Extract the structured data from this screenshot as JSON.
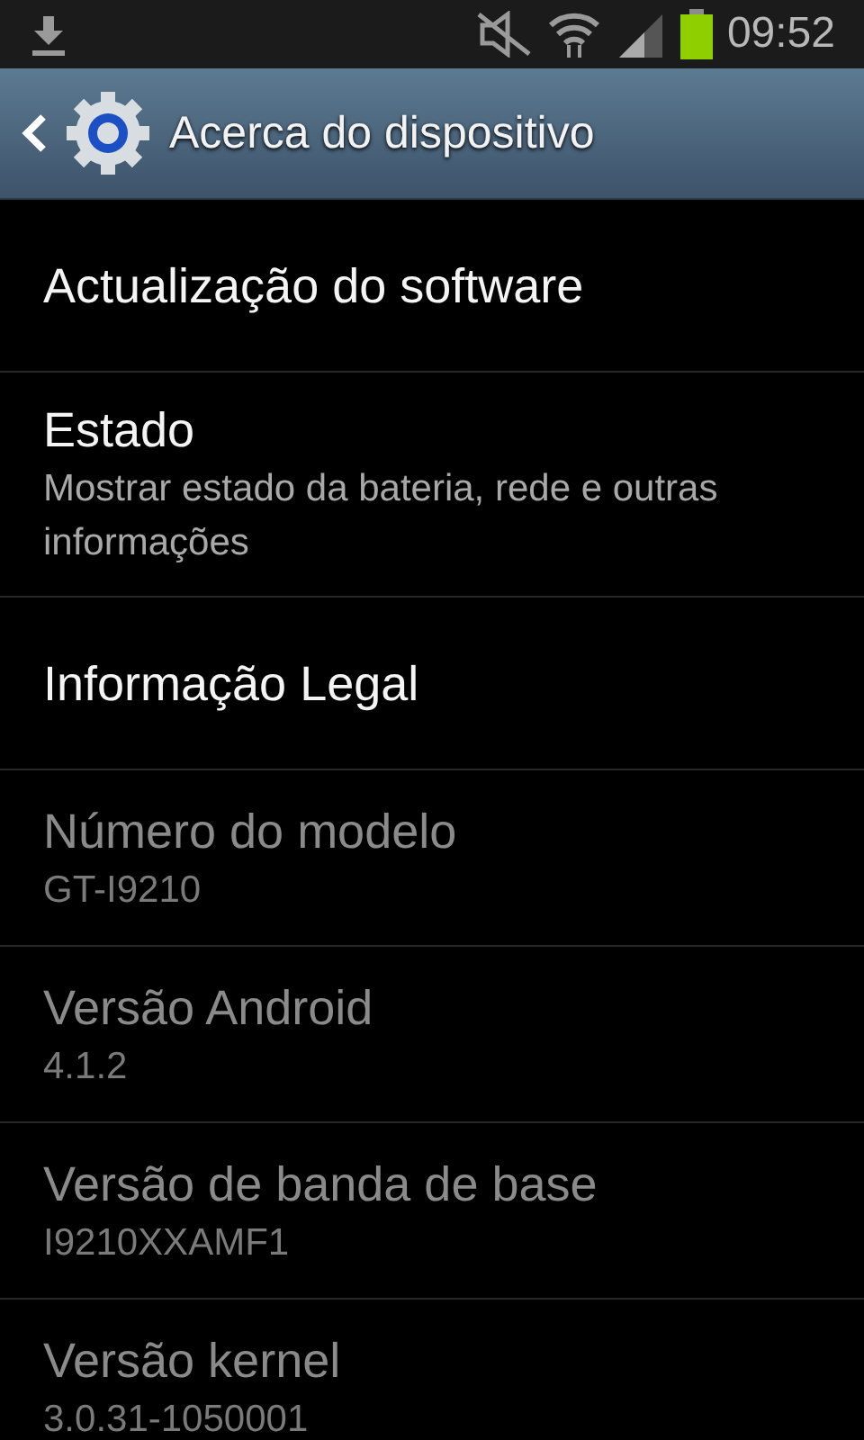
{
  "status_bar": {
    "time": "09:52"
  },
  "action_bar": {
    "title": "Acerca do dispositivo"
  },
  "items": [
    {
      "title": "Actualização do software",
      "disabled": false
    },
    {
      "title": "Estado",
      "summary": "Mostrar estado da bateria, rede e outras informações",
      "disabled": false
    },
    {
      "title": "Informação Legal",
      "disabled": false
    },
    {
      "title": "Número do modelo",
      "summary": "GT-I9210",
      "disabled": true
    },
    {
      "title": "Versão Android",
      "summary": "4.1.2",
      "disabled": true
    },
    {
      "title": "Versão de banda de base",
      "summary": "I9210XXAMF1",
      "disabled": true
    },
    {
      "title": "Versão kernel",
      "summary": "3.0.31-1050001",
      "disabled": true
    }
  ]
}
